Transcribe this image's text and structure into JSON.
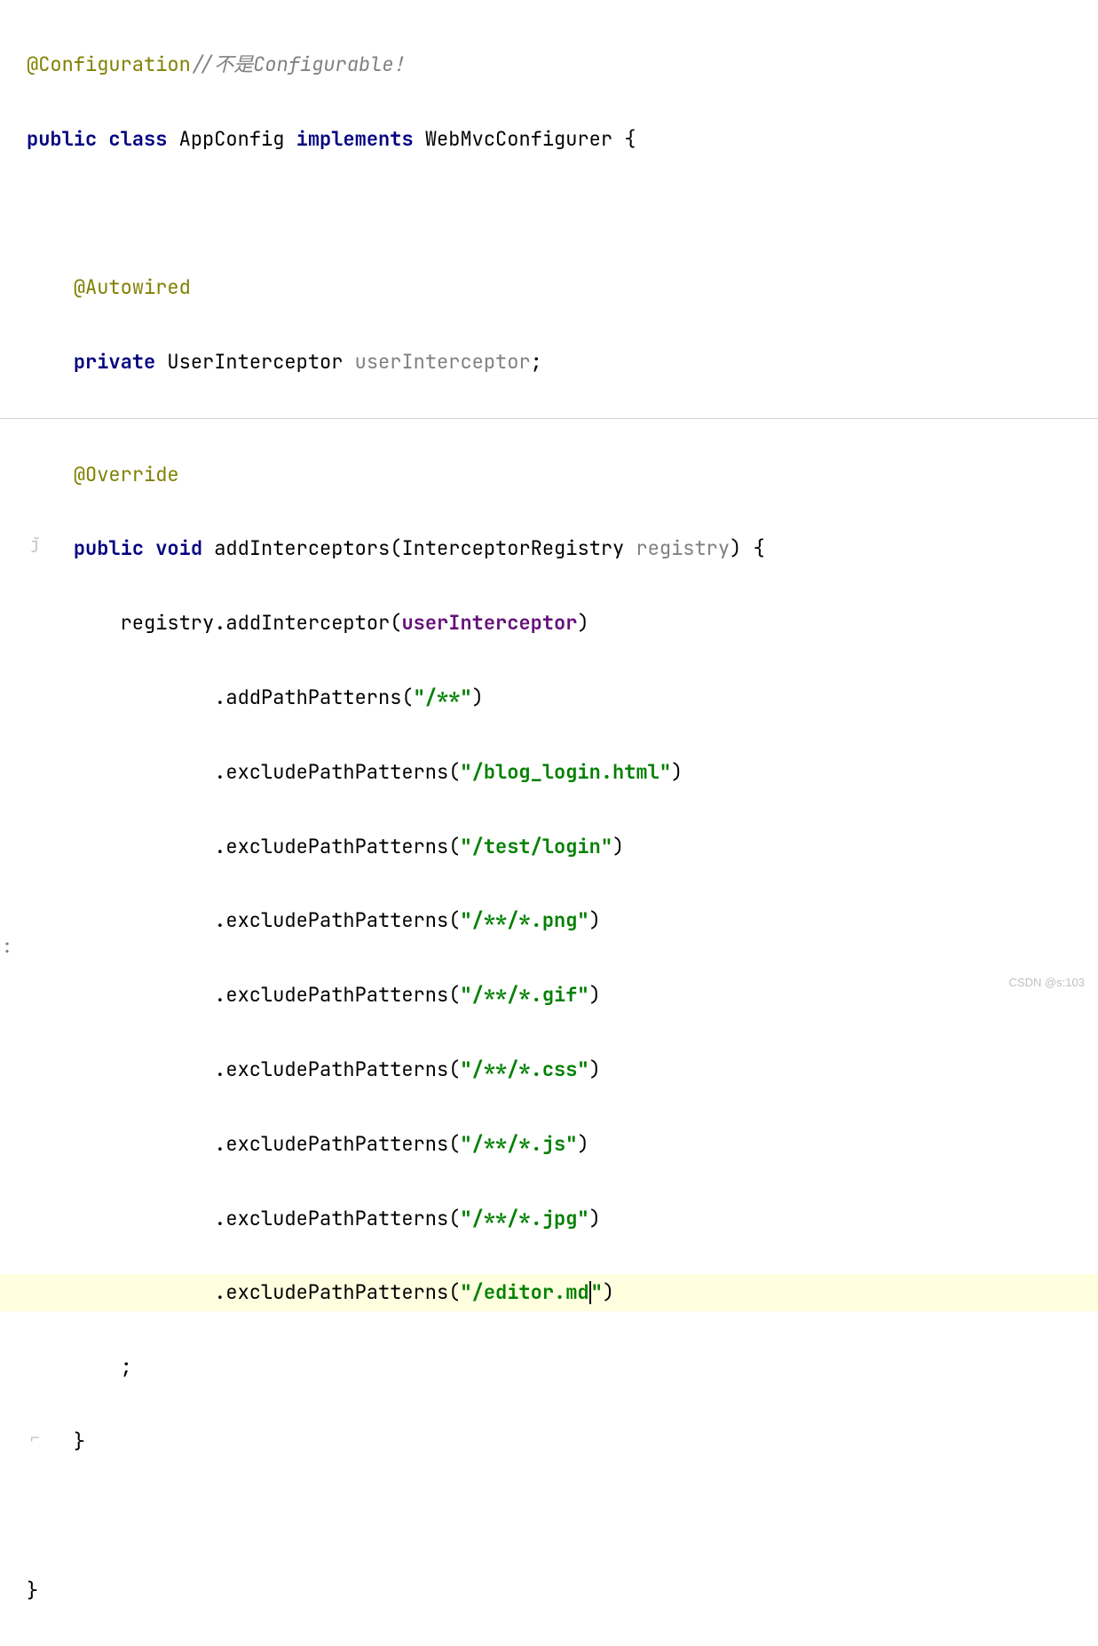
{
  "code": {
    "annotation_configuration": "@Configuration",
    "comment_line1": "//不是Configurable！",
    "kw_public": "public",
    "kw_class": "class",
    "class_appconfig": "AppConfig",
    "kw_implements": "implements",
    "iface_webmvc": "WebMvcConfigurer",
    "brace_open": "{",
    "brace_close": "}",
    "annotation_autowired": "@Autowired",
    "kw_private": "private",
    "type_userinterceptor": "UserInterceptor",
    "field_userinterceptor": "userInterceptor",
    "semi": ";",
    "annotation_override": "@Override",
    "kw_void": "void",
    "method_addinterceptors": "addInterceptors",
    "paren_open": "(",
    "paren_close": ")",
    "type_registry": "InterceptorRegistry",
    "param_registry": "registry",
    "var_registry": "registry",
    "dot": ".",
    "method_addinterceptor": "addInterceptor",
    "field_userinterceptor2": "userInterceptor",
    "method_addpathpatterns": "addPathPatterns",
    "str_allpaths": "\"/**\"",
    "method_excludepathpatterns": "excludePathPatterns",
    "str_bloglogin": "\"/blog_login.html\"",
    "str_testlogin": "\"/test/login\"",
    "str_png": "\"/**/*.png\"",
    "str_gif": "\"/**/*.gif\"",
    "str_css": "\"/**/*.css\"",
    "str_js": "\"/**/*.js\"",
    "str_jpg": "\"/**/*.jpg\"",
    "str_editormd_pre": "\"/editor.md",
    "str_editormd_post": "\""
  },
  "watermark": "CSDN @s:103",
  "gutter": {
    "override_icon": "ǰ",
    "method_end_icon": "⌐"
  },
  "bottom_colon": ":"
}
